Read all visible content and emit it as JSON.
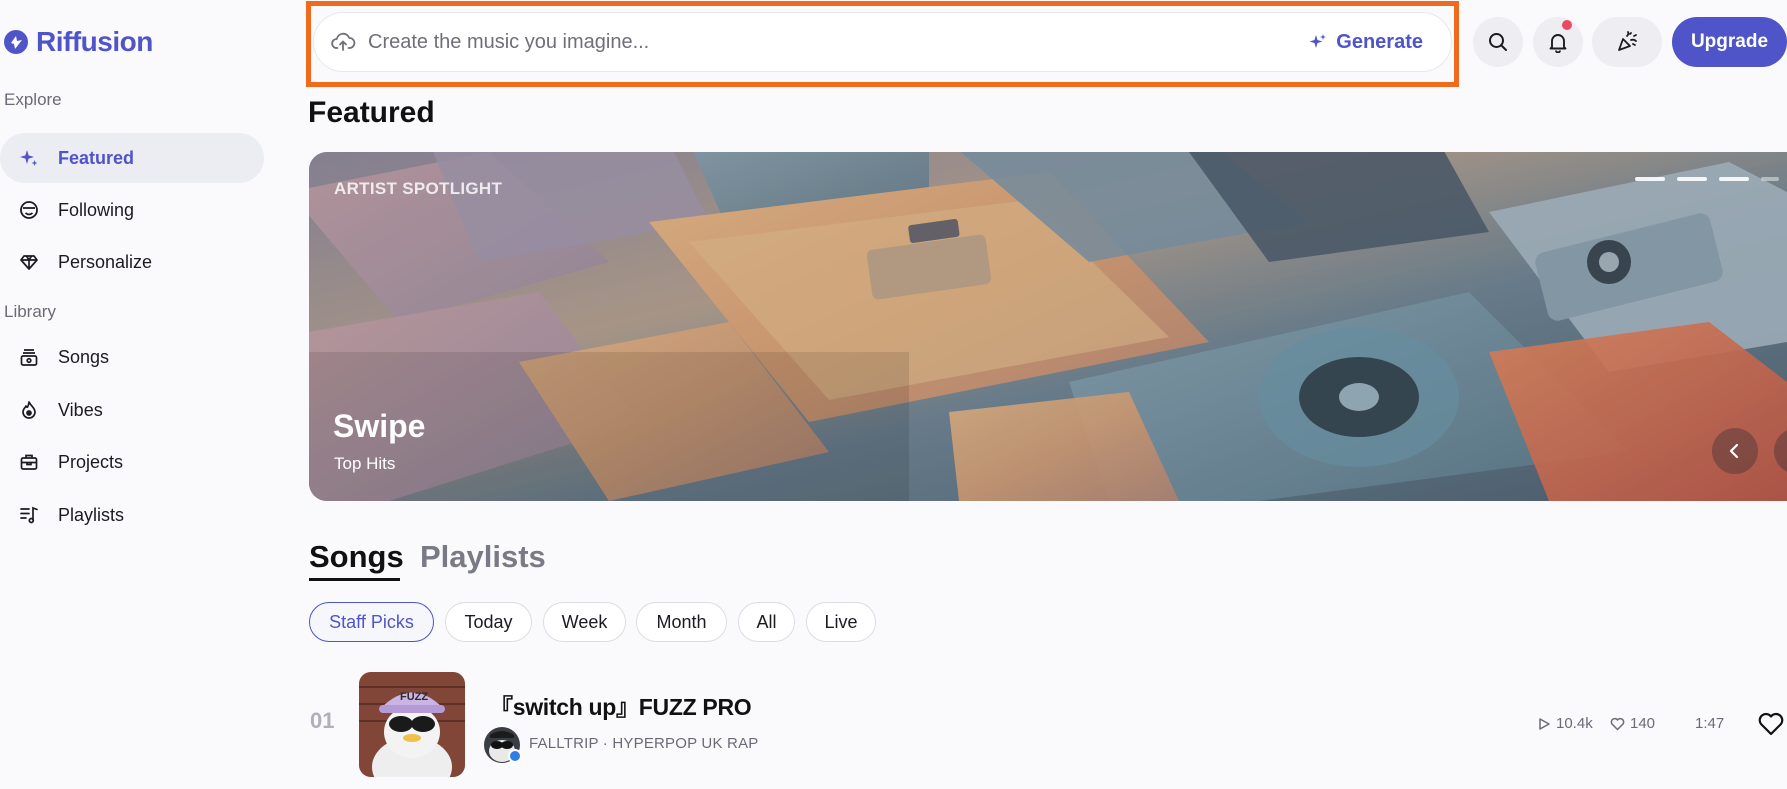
{
  "app": {
    "name": "Riffusion",
    "brand_color": "#4f54c9"
  },
  "sidebar": {
    "explore_label": "Explore",
    "library_label": "Library",
    "explore_items": [
      {
        "label": "Featured",
        "icon": "sparkle-icon",
        "active": true
      },
      {
        "label": "Following",
        "icon": "smiley-icon"
      },
      {
        "label": "Personalize",
        "icon": "diamond-icon"
      }
    ],
    "library_items": [
      {
        "label": "Songs",
        "icon": "record-stack-icon"
      },
      {
        "label": "Vibes",
        "icon": "flame-icon"
      },
      {
        "label": "Projects",
        "icon": "briefcase-icon"
      },
      {
        "label": "Playlists",
        "icon": "playlist-icon"
      }
    ]
  },
  "topbar": {
    "prompt_placeholder": "Create the music you imagine...",
    "generate_label": "Generate",
    "upgrade_label": "Upgrade",
    "highlight_color": "#f06a1e"
  },
  "featured": {
    "title": "Featured",
    "banner": {
      "kicker": "ARTIST SPOTLIGHT",
      "title": "Swipe",
      "subtitle": "Top Hits"
    }
  },
  "content_tabs": [
    {
      "label": "Songs",
      "active": true
    },
    {
      "label": "Playlists",
      "active": false
    }
  ],
  "filters": [
    {
      "label": "Staff Picks",
      "active": true
    },
    {
      "label": "Today"
    },
    {
      "label": "Week"
    },
    {
      "label": "Month"
    },
    {
      "label": "All"
    },
    {
      "label": "Live"
    }
  ],
  "songs": [
    {
      "rank": "01",
      "title": "『switch up』FUZZ PRO",
      "artist": "FALLTRIP",
      "genre": "HYPERPOP UK RAP",
      "plays": "10.4k",
      "likes": "140",
      "duration": "1:47"
    }
  ]
}
